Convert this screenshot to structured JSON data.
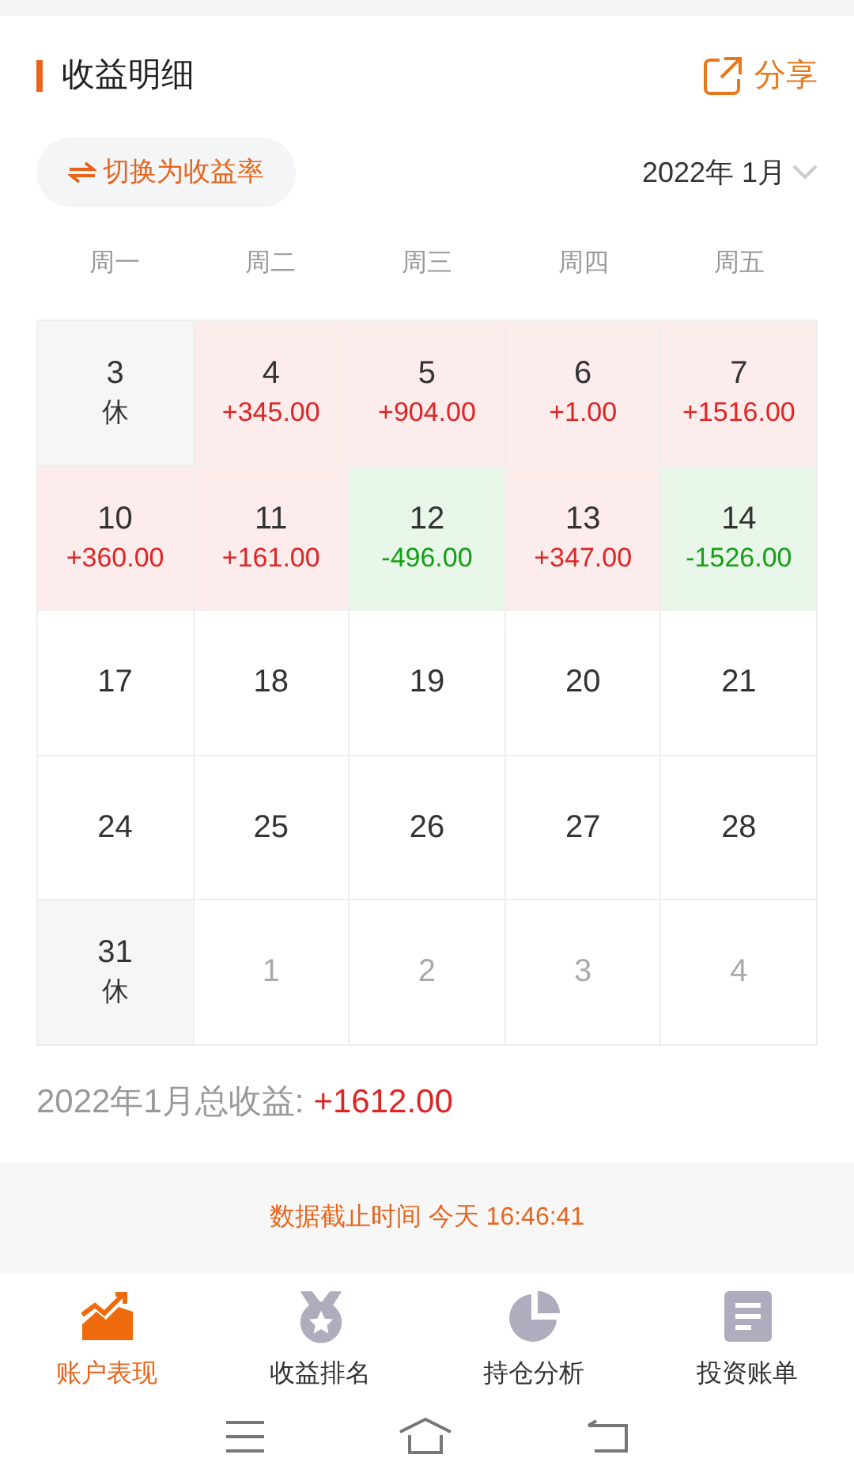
{
  "header": {
    "title": "收益明细",
    "share": "分享"
  },
  "toggle": {
    "label": "切换为收益率"
  },
  "month_picker": {
    "label": "2022年 1月"
  },
  "weekdays": [
    "周一",
    "周二",
    "周三",
    "周四",
    "周五"
  ],
  "calendar": [
    {
      "day": "3",
      "kind": "rest",
      "note": "休"
    },
    {
      "day": "4",
      "kind": "gain",
      "note": "+345.00"
    },
    {
      "day": "5",
      "kind": "gain",
      "note": "+904.00"
    },
    {
      "day": "6",
      "kind": "gain",
      "note": "+1.00"
    },
    {
      "day": "7",
      "kind": "gain",
      "note": "+1516.00"
    },
    {
      "day": "10",
      "kind": "gain",
      "note": "+360.00"
    },
    {
      "day": "11",
      "kind": "gain",
      "note": "+161.00"
    },
    {
      "day": "12",
      "kind": "loss",
      "note": "-496.00"
    },
    {
      "day": "13",
      "kind": "gain",
      "note": "+347.00"
    },
    {
      "day": "14",
      "kind": "loss",
      "note": "-1526.00"
    },
    {
      "day": "17",
      "kind": "plain"
    },
    {
      "day": "18",
      "kind": "plain"
    },
    {
      "day": "19",
      "kind": "plain"
    },
    {
      "day": "20",
      "kind": "plain"
    },
    {
      "day": "21",
      "kind": "plain"
    },
    {
      "day": "24",
      "kind": "plain"
    },
    {
      "day": "25",
      "kind": "plain"
    },
    {
      "day": "26",
      "kind": "plain"
    },
    {
      "day": "27",
      "kind": "plain"
    },
    {
      "day": "28",
      "kind": "plain"
    },
    {
      "day": "31",
      "kind": "rest",
      "note": "休"
    },
    {
      "day": "1",
      "kind": "other"
    },
    {
      "day": "2",
      "kind": "other"
    },
    {
      "day": "3",
      "kind": "other"
    },
    {
      "day": "4",
      "kind": "other"
    }
  ],
  "total": {
    "label": "2022年1月总收益:",
    "value": "+1612.00"
  },
  "updated": "数据截止时间 今天 16:46:41",
  "tabs": [
    {
      "label": "账户表现",
      "selected": true,
      "kind": "chart"
    },
    {
      "label": "收益排名",
      "selected": false,
      "kind": "medal"
    },
    {
      "label": "持仓分析",
      "selected": false,
      "kind": "pie"
    },
    {
      "label": "投资账单",
      "selected": false,
      "kind": "doc"
    }
  ]
}
